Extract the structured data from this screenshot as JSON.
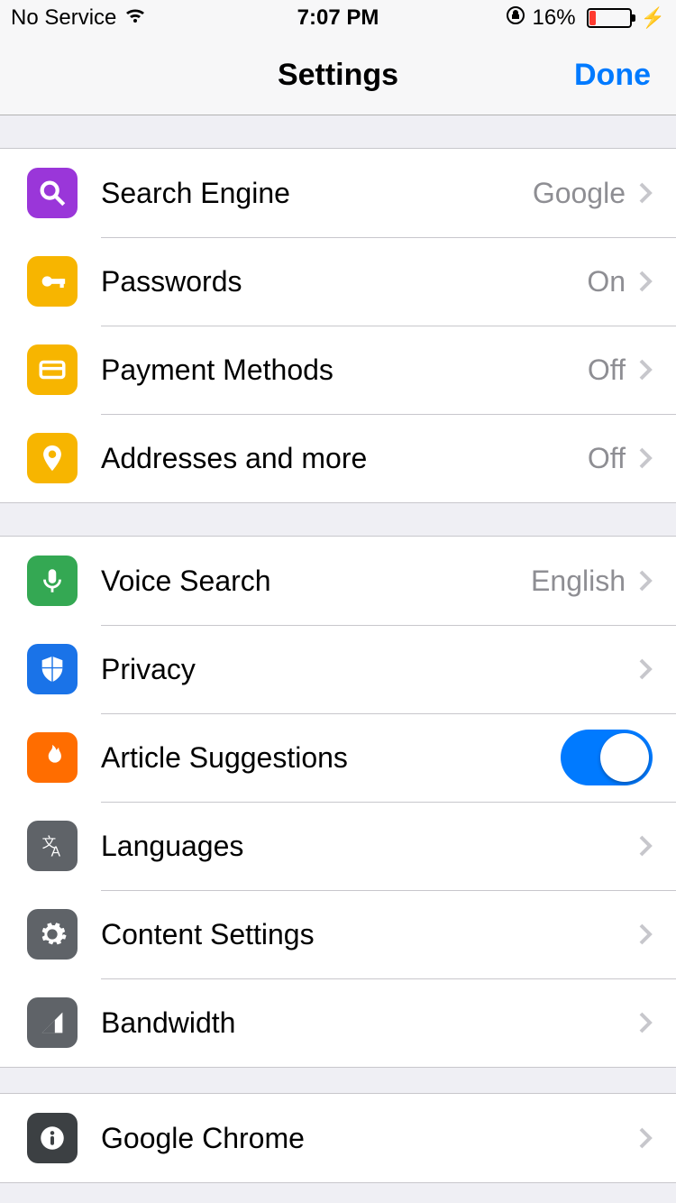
{
  "status": {
    "carrier": "No Service",
    "time": "7:07 PM",
    "battery_pct": "16%"
  },
  "nav": {
    "title": "Settings",
    "done": "Done"
  },
  "g1": {
    "search": {
      "label": "Search Engine",
      "value": "Google"
    },
    "pwd": {
      "label": "Passwords",
      "value": "On"
    },
    "pay": {
      "label": "Payment Methods",
      "value": "Off"
    },
    "addr": {
      "label": "Addresses and more",
      "value": "Off"
    }
  },
  "g2": {
    "voice": {
      "label": "Voice Search",
      "value": "English"
    },
    "privacy": {
      "label": "Privacy"
    },
    "articles": {
      "label": "Article Suggestions",
      "toggle": true
    },
    "lang": {
      "label": "Languages"
    },
    "content": {
      "label": "Content Settings"
    },
    "bw": {
      "label": "Bandwidth"
    }
  },
  "g3": {
    "chrome": {
      "label": "Google Chrome"
    }
  }
}
